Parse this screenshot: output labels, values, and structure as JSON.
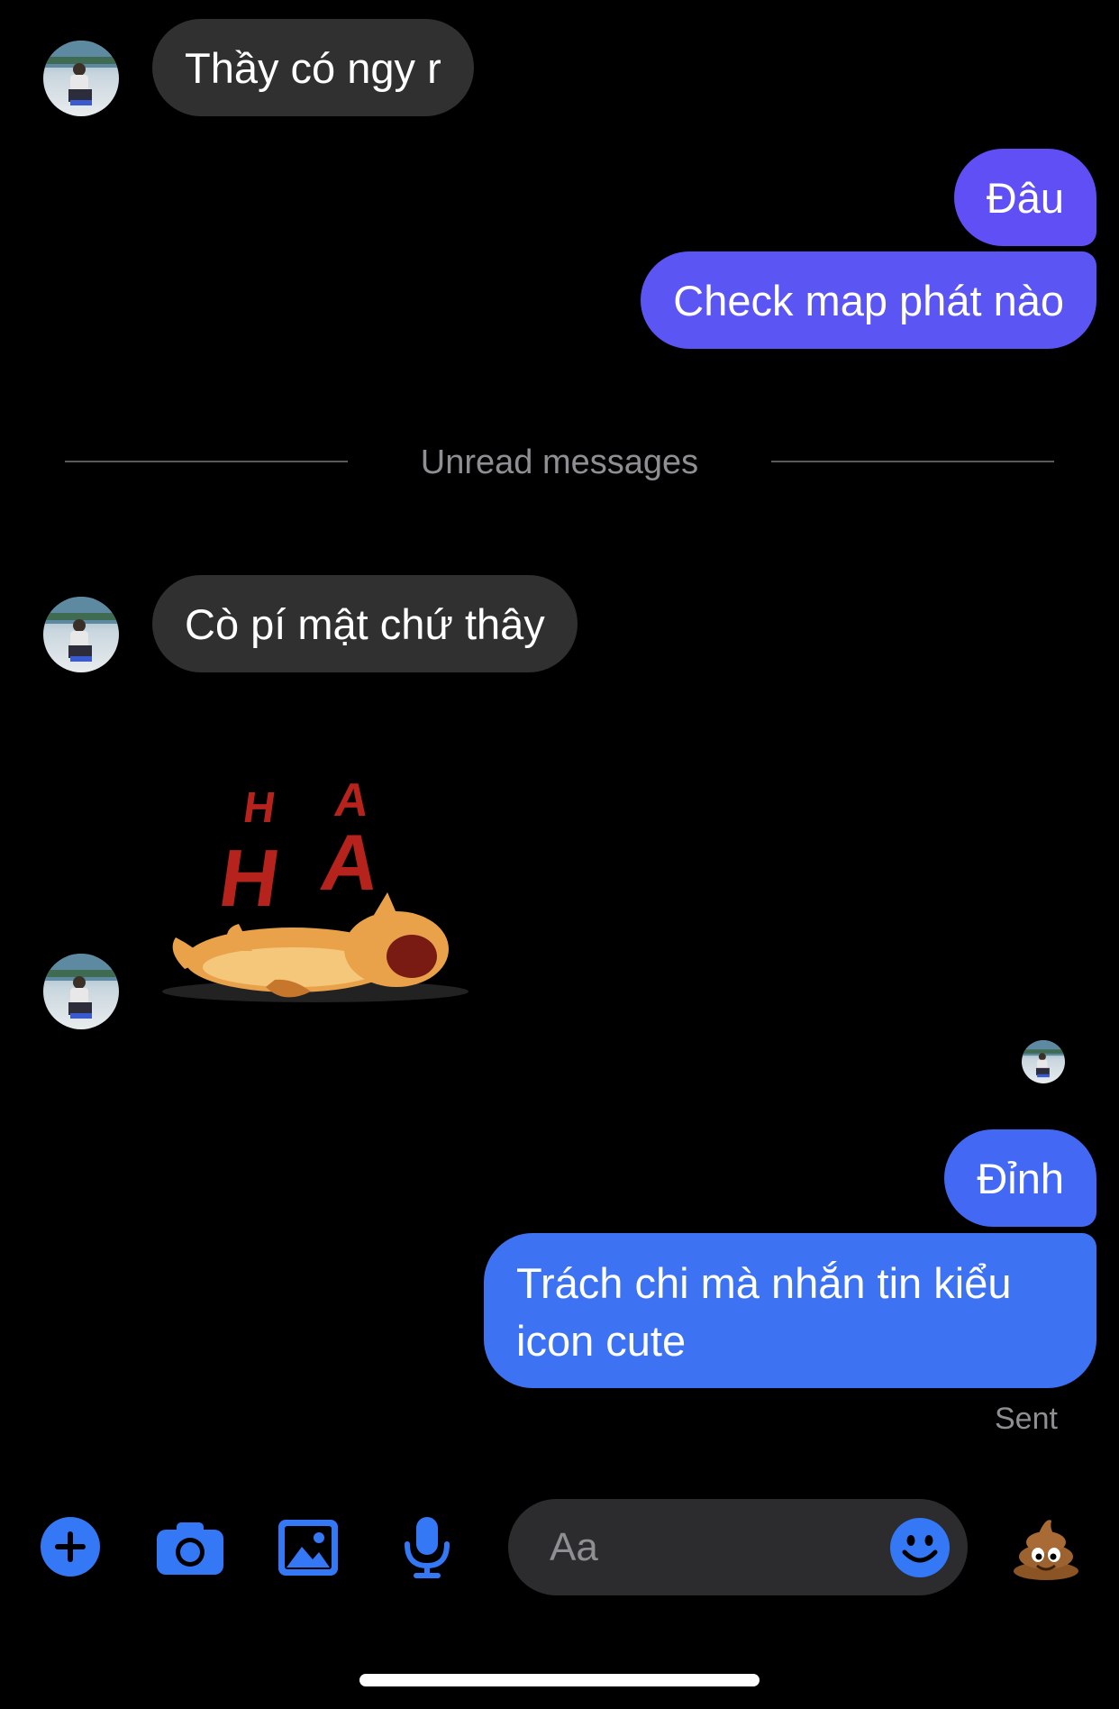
{
  "messages": [
    {
      "id": "m1",
      "direction": "incoming",
      "text": "Thầy có ngy r"
    },
    {
      "id": "m2",
      "direction": "outgoing",
      "text": "Đâu"
    },
    {
      "id": "m3",
      "direction": "outgoing",
      "text": "Check map phát nào"
    },
    {
      "id": "m4",
      "direction": "incoming",
      "text": "Cò pí mật chứ thây"
    },
    {
      "id": "m5",
      "direction": "incoming",
      "type": "sticker",
      "sticker_text": "HAHA",
      "icon": "laughing-dog-sticker"
    },
    {
      "id": "m6",
      "direction": "outgoing",
      "text": "Đỉnh"
    },
    {
      "id": "m7",
      "direction": "outgoing",
      "text": "Trách chi mà nhắn tin kiểu icon cute"
    }
  ],
  "divider": {
    "label": "Unread messages"
  },
  "status": {
    "sent_label": "Sent"
  },
  "composer": {
    "placeholder": "Aa",
    "icons": [
      "plus-icon",
      "camera-icon",
      "photo-icon",
      "microphone-icon",
      "emoji-icon",
      "poop-emoji-icon"
    ]
  },
  "colors": {
    "background": "#000000",
    "incoming_bubble": "#303030",
    "outgoing_top": "#6a50f0",
    "outgoing_bottom": "#3d73f2",
    "accent": "#3478f6",
    "muted_text": "#8e8e93"
  }
}
